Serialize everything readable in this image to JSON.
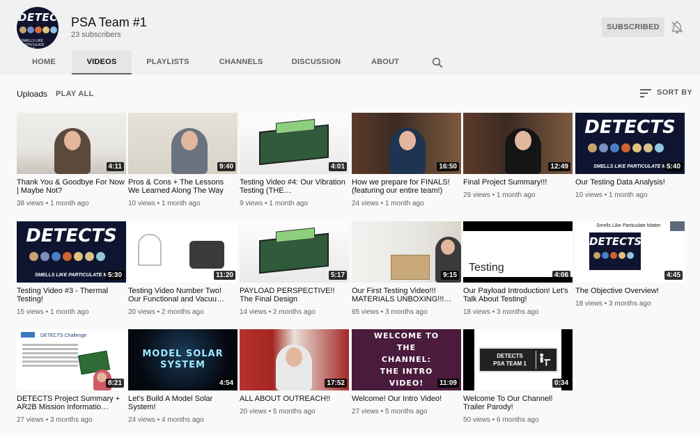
{
  "channel": {
    "name": "PSA Team #1",
    "subscribers": "23 subscribers",
    "avatar_text": "DETECTS",
    "avatar_subtext": "SMELLS LIKE PARTICULATE MATTER",
    "subscribe_label": "SUBSCRIBED",
    "bell_icon": "bell-off-icon"
  },
  "tabs": [
    {
      "label": "HOME"
    },
    {
      "label": "VIDEOS"
    },
    {
      "label": "PLAYLISTS"
    },
    {
      "label": "CHANNELS"
    },
    {
      "label": "DISCUSSION"
    },
    {
      "label": "ABOUT"
    }
  ],
  "uploads": {
    "title": "Uploads",
    "play_all": "PLAY ALL",
    "sort_by": "SORT BY"
  },
  "thumb_text": {
    "detects": "DETECTS",
    "smells": "SMELLS LIKE PARTICULATE MATT",
    "testing": "Testing",
    "smells_pm": "Smells Like Particulate Matter",
    "challenge": "DETECTS Challenge",
    "model_solar_1": "MODEL SOLAR",
    "model_solar_2": "SYSTEM",
    "welcome_1": "WELCOME TO",
    "welcome_2": "THE",
    "welcome_3": "CHANNEL:",
    "welcome_4": "THE INTRO",
    "welcome_5": "VIDEO!",
    "sign_1": "DETECTS",
    "sign_2": "PSA TEAM 1"
  },
  "videos": [
    {
      "title": "Thank You & Goodbye For Now | Maybe Not?",
      "meta": "38 views • 1 month ago",
      "duration": "4:11"
    },
    {
      "title": "Pros & Cons + The Lessons We Learned Along The Way",
      "meta": "10 views • 1 month ago",
      "duration": "9:40"
    },
    {
      "title": "Testing Video #4: Our Vibration Testing (THE…",
      "meta": "9 views • 1 month ago",
      "duration": "4:01"
    },
    {
      "title": "How we prepare for FINALS! (featuring our entire team!)",
      "meta": "24 views • 1 month ago",
      "duration": "16:50"
    },
    {
      "title": "Final Project Summary!!!",
      "meta": "29 views • 1 month ago",
      "duration": "12:49"
    },
    {
      "title": "Our Testing Data Analysis!",
      "meta": "10 views • 1 month ago",
      "duration": "5:40"
    },
    {
      "title": "Testing Video #3 - Thermal Testing!",
      "meta": "15 views • 1 month ago",
      "duration": "5:30"
    },
    {
      "title": "Testing Video Number Two! Our Functional and Vacuu…",
      "meta": "20 views • 2 months ago",
      "duration": "11:20"
    },
    {
      "title": "PAYLOAD PERSPECTIVE!! The Final Design",
      "meta": "14 views • 2 months ago",
      "duration": "5:17"
    },
    {
      "title": "Our First Testing Video!!! MATERIALS UNBOXING!!!…",
      "meta": "65 views • 3 months ago",
      "duration": "9:15"
    },
    {
      "title": "Our Payload Introduction! Let's Talk About Testing!",
      "meta": "18 views • 3 months ago",
      "duration": "4:06"
    },
    {
      "title": "The Objective Overview!",
      "meta": "18 views • 3 months ago",
      "duration": "4:45"
    },
    {
      "title": "DETECTS Project Summary + AR2B Mission Informatio…",
      "meta": "27 views • 3 months ago",
      "duration": "8:21"
    },
    {
      "title": "Let's Build A Model Solar System!",
      "meta": "24 views • 4 months ago",
      "duration": "4:54"
    },
    {
      "title": "ALL ABOUT OUTREACH!!",
      "meta": "20 views • 5 months ago",
      "duration": "17:52"
    },
    {
      "title": "Welcome! Our Intro Video!",
      "meta": "27 views • 5 months ago",
      "duration": "11:09"
    },
    {
      "title": "Welcome To Our Channel! Trailer Parody!",
      "meta": "50 views • 6 months ago",
      "duration": "0:34"
    }
  ]
}
